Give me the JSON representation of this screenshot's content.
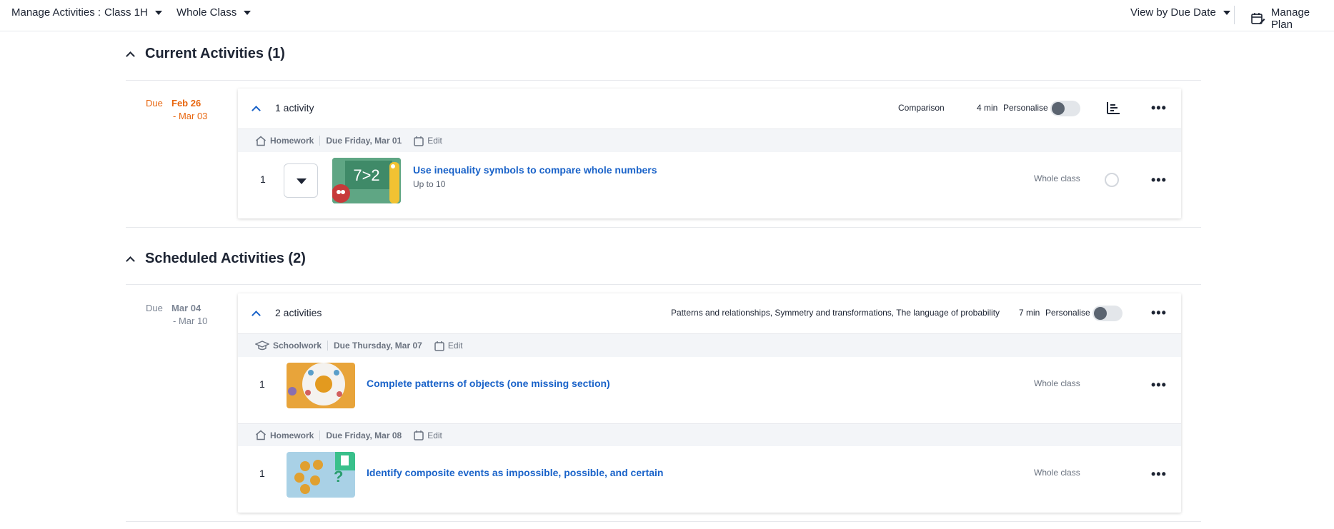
{
  "topbar": {
    "label": "Manage Activities :",
    "class_select": "Class 1H",
    "group_select": "Whole Class",
    "view_select": "View by Due Date",
    "manage_plan": "Manage Plan"
  },
  "current": {
    "title": "Current Activities (1)",
    "due_label": "Due",
    "due_start": "Feb 26",
    "due_end": "- Mar 03",
    "card": {
      "count": "1 activity",
      "strand": "Comparison",
      "minutes": "4 min",
      "personalise": "Personalise",
      "groups": [
        {
          "type": "Homework",
          "due": "Due Friday, Mar 01",
          "edit": "Edit",
          "activities": [
            {
              "number": "1",
              "title": "Use inequality symbols to compare whole numbers",
              "subtitle": "Up to 10",
              "assigned": "Whole class",
              "thumb_text": "7>2"
            }
          ]
        }
      ]
    }
  },
  "scheduled": {
    "title": "Scheduled Activities (2)",
    "due_label": "Due",
    "due_start": "Mar 04",
    "due_end": "- Mar 10",
    "card": {
      "count": "2 activities",
      "strand": "Patterns and relationships, Symmetry and transformations, The language of probability",
      "minutes": "7 min",
      "personalise": "Personalise",
      "groups": [
        {
          "type": "Schoolwork",
          "due": "Due Thursday, Mar 07",
          "edit": "Edit",
          "activities": [
            {
              "number": "1",
              "title": "Complete patterns of objects (one missing section)",
              "assigned": "Whole class"
            }
          ]
        },
        {
          "type": "Homework",
          "due": "Due Friday, Mar 08",
          "edit": "Edit",
          "activities": [
            {
              "number": "1",
              "title": "Identify composite events as impossible, possible, and certain",
              "assigned": "Whole class"
            }
          ]
        }
      ]
    }
  },
  "colors": {
    "accent": "#1a63c9",
    "due_current": "#e8660f",
    "text": "#1d2433",
    "muted": "#6b7380"
  }
}
